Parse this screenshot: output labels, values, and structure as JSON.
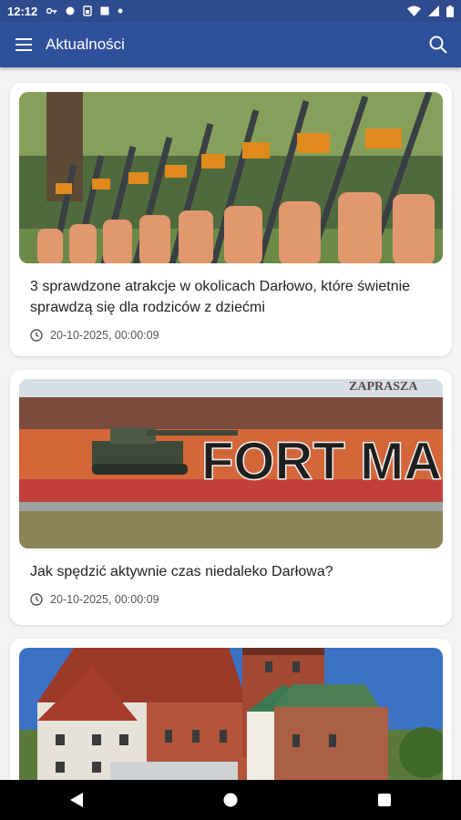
{
  "status_bar": {
    "time": "12:12",
    "notification_icons": [
      "key-icon",
      "dot-icon",
      "sim-icon",
      "stop-icon",
      "dot-icon"
    ],
    "right_icons": [
      "wifi-icon",
      "signal-icon",
      "battery-icon"
    ]
  },
  "app_bar": {
    "title": "Aktualności",
    "menu_icon": "hamburger-menu-icon",
    "search_icon": "search-icon",
    "background": "#2f519c"
  },
  "articles": [
    {
      "title": "3 sprawdzone atrakcje w okolicach Darłowo, które świetnie sprawdzą się dla rodziców z dziećmi",
      "date": "20-10-2025, 00:00:09"
    },
    {
      "title": "Jak spędzić aktywnie czas niedaleko Darłowa?",
      "date": "20-10-2025, 00:00:09",
      "image_text": "FORT MARIAN",
      "image_banner": "ZAPRASZA"
    },
    {
      "title": "",
      "date": ""
    }
  ],
  "nav_bar": {
    "back_icon": "back-triangle-icon",
    "home_icon": "home-circle-icon",
    "recents_icon": "recents-square-icon"
  }
}
